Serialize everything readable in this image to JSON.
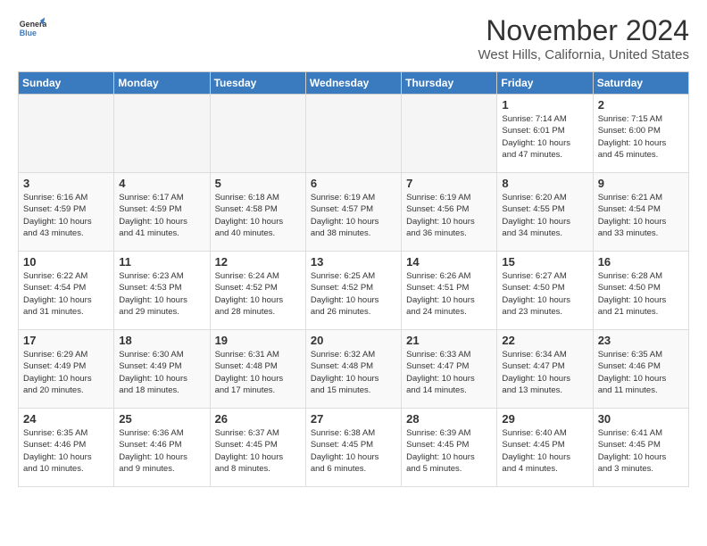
{
  "header": {
    "logo_line1": "General",
    "logo_line2": "Blue",
    "month": "November 2024",
    "location": "West Hills, California, United States"
  },
  "weekdays": [
    "Sunday",
    "Monday",
    "Tuesday",
    "Wednesday",
    "Thursday",
    "Friday",
    "Saturday"
  ],
  "weeks": [
    [
      {
        "day": "",
        "info": ""
      },
      {
        "day": "",
        "info": ""
      },
      {
        "day": "",
        "info": ""
      },
      {
        "day": "",
        "info": ""
      },
      {
        "day": "",
        "info": ""
      },
      {
        "day": "1",
        "info": "Sunrise: 7:14 AM\nSunset: 6:01 PM\nDaylight: 10 hours\nand 47 minutes."
      },
      {
        "day": "2",
        "info": "Sunrise: 7:15 AM\nSunset: 6:00 PM\nDaylight: 10 hours\nand 45 minutes."
      }
    ],
    [
      {
        "day": "3",
        "info": "Sunrise: 6:16 AM\nSunset: 4:59 PM\nDaylight: 10 hours\nand 43 minutes."
      },
      {
        "day": "4",
        "info": "Sunrise: 6:17 AM\nSunset: 4:59 PM\nDaylight: 10 hours\nand 41 minutes."
      },
      {
        "day": "5",
        "info": "Sunrise: 6:18 AM\nSunset: 4:58 PM\nDaylight: 10 hours\nand 40 minutes."
      },
      {
        "day": "6",
        "info": "Sunrise: 6:19 AM\nSunset: 4:57 PM\nDaylight: 10 hours\nand 38 minutes."
      },
      {
        "day": "7",
        "info": "Sunrise: 6:19 AM\nSunset: 4:56 PM\nDaylight: 10 hours\nand 36 minutes."
      },
      {
        "day": "8",
        "info": "Sunrise: 6:20 AM\nSunset: 4:55 PM\nDaylight: 10 hours\nand 34 minutes."
      },
      {
        "day": "9",
        "info": "Sunrise: 6:21 AM\nSunset: 4:54 PM\nDaylight: 10 hours\nand 33 minutes."
      }
    ],
    [
      {
        "day": "10",
        "info": "Sunrise: 6:22 AM\nSunset: 4:54 PM\nDaylight: 10 hours\nand 31 minutes."
      },
      {
        "day": "11",
        "info": "Sunrise: 6:23 AM\nSunset: 4:53 PM\nDaylight: 10 hours\nand 29 minutes."
      },
      {
        "day": "12",
        "info": "Sunrise: 6:24 AM\nSunset: 4:52 PM\nDaylight: 10 hours\nand 28 minutes."
      },
      {
        "day": "13",
        "info": "Sunrise: 6:25 AM\nSunset: 4:52 PM\nDaylight: 10 hours\nand 26 minutes."
      },
      {
        "day": "14",
        "info": "Sunrise: 6:26 AM\nSunset: 4:51 PM\nDaylight: 10 hours\nand 24 minutes."
      },
      {
        "day": "15",
        "info": "Sunrise: 6:27 AM\nSunset: 4:50 PM\nDaylight: 10 hours\nand 23 minutes."
      },
      {
        "day": "16",
        "info": "Sunrise: 6:28 AM\nSunset: 4:50 PM\nDaylight: 10 hours\nand 21 minutes."
      }
    ],
    [
      {
        "day": "17",
        "info": "Sunrise: 6:29 AM\nSunset: 4:49 PM\nDaylight: 10 hours\nand 20 minutes."
      },
      {
        "day": "18",
        "info": "Sunrise: 6:30 AM\nSunset: 4:49 PM\nDaylight: 10 hours\nand 18 minutes."
      },
      {
        "day": "19",
        "info": "Sunrise: 6:31 AM\nSunset: 4:48 PM\nDaylight: 10 hours\nand 17 minutes."
      },
      {
        "day": "20",
        "info": "Sunrise: 6:32 AM\nSunset: 4:48 PM\nDaylight: 10 hours\nand 15 minutes."
      },
      {
        "day": "21",
        "info": "Sunrise: 6:33 AM\nSunset: 4:47 PM\nDaylight: 10 hours\nand 14 minutes."
      },
      {
        "day": "22",
        "info": "Sunrise: 6:34 AM\nSunset: 4:47 PM\nDaylight: 10 hours\nand 13 minutes."
      },
      {
        "day": "23",
        "info": "Sunrise: 6:35 AM\nSunset: 4:46 PM\nDaylight: 10 hours\nand 11 minutes."
      }
    ],
    [
      {
        "day": "24",
        "info": "Sunrise: 6:35 AM\nSunset: 4:46 PM\nDaylight: 10 hours\nand 10 minutes."
      },
      {
        "day": "25",
        "info": "Sunrise: 6:36 AM\nSunset: 4:46 PM\nDaylight: 10 hours\nand 9 minutes."
      },
      {
        "day": "26",
        "info": "Sunrise: 6:37 AM\nSunset: 4:45 PM\nDaylight: 10 hours\nand 8 minutes."
      },
      {
        "day": "27",
        "info": "Sunrise: 6:38 AM\nSunset: 4:45 PM\nDaylight: 10 hours\nand 6 minutes."
      },
      {
        "day": "28",
        "info": "Sunrise: 6:39 AM\nSunset: 4:45 PM\nDaylight: 10 hours\nand 5 minutes."
      },
      {
        "day": "29",
        "info": "Sunrise: 6:40 AM\nSunset: 4:45 PM\nDaylight: 10 hours\nand 4 minutes."
      },
      {
        "day": "30",
        "info": "Sunrise: 6:41 AM\nSunset: 4:45 PM\nDaylight: 10 hours\nand 3 minutes."
      }
    ]
  ]
}
